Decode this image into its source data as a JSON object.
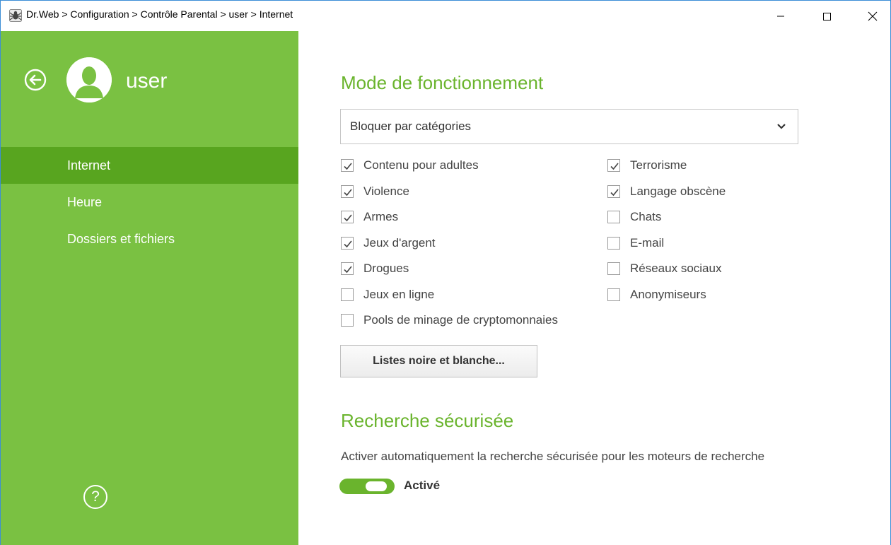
{
  "window": {
    "title": "Dr.Web > Configuration > Contrôle Parental > user > Internet"
  },
  "sidebar": {
    "user_name": "user",
    "items": [
      {
        "label": "Internet",
        "active": true
      },
      {
        "label": "Heure",
        "active": false
      },
      {
        "label": "Dossiers et fichiers",
        "active": false
      }
    ],
    "help_label": "?"
  },
  "main": {
    "mode_title": "Mode de fonctionnement",
    "mode_dropdown": {
      "selected": "Bloquer par catégories"
    },
    "categories_left": [
      {
        "label": "Contenu pour adultes",
        "checked": true
      },
      {
        "label": "Violence",
        "checked": true
      },
      {
        "label": "Armes",
        "checked": true
      },
      {
        "label": "Jeux d'argent",
        "checked": true
      },
      {
        "label": "Drogues",
        "checked": true
      },
      {
        "label": "Jeux en ligne",
        "checked": false
      },
      {
        "label": "Pools de minage de cryptomonnaies",
        "checked": false
      }
    ],
    "categories_right": [
      {
        "label": "Terrorisme",
        "checked": true
      },
      {
        "label": "Langage obscène",
        "checked": true
      },
      {
        "label": "Chats",
        "checked": false
      },
      {
        "label": "E-mail",
        "checked": false
      },
      {
        "label": "Réseaux sociaux",
        "checked": false
      },
      {
        "label": "Anonymiseurs",
        "checked": false
      }
    ],
    "lists_button": "Listes noire et blanche...",
    "safe_search_title": "Recherche sécurisée",
    "safe_search_desc": "Activer automatiquement la recherche sécurisée pour les moteurs de recherche",
    "safe_search_toggle": {
      "on": true,
      "label": "Activé"
    }
  },
  "colors": {
    "sidebar_bg": "#7ac142",
    "sidebar_active": "#58a51f",
    "accent": "#6ab42d"
  }
}
